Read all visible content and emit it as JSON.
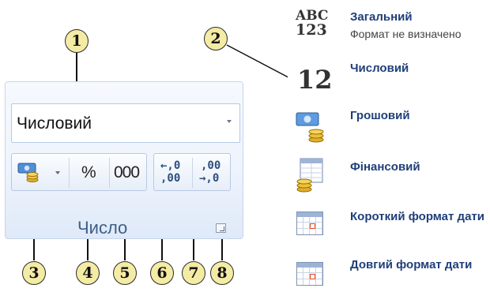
{
  "callouts": [
    "1",
    "2",
    "3",
    "4",
    "5",
    "6",
    "7",
    "8"
  ],
  "ribbon": {
    "format_value": "Числовий",
    "percent_label": "%",
    "thousands_label": "000",
    "increase_decimal": {
      "top": "←,0",
      "bottom": ",00"
    },
    "decrease_decimal": {
      "top": ",00",
      "bottom": "→,0"
    },
    "group_label": "Число"
  },
  "format_list": [
    {
      "icon": "abc-123-icon",
      "title": "Загальний",
      "subtitle": "Формат не визначено",
      "glyph_top": "ABC",
      "glyph_bottom": "123"
    },
    {
      "icon": "number-12-icon",
      "title": "Числовий",
      "glyph": "12"
    },
    {
      "icon": "currency-icon",
      "title": "Грошовий"
    },
    {
      "icon": "accounting-icon",
      "title": "Фінансовий"
    },
    {
      "icon": "calendar-icon",
      "title": "Короткий формат дати"
    },
    {
      "icon": "calendar-icon",
      "title": "Довгий формат дати"
    }
  ]
}
